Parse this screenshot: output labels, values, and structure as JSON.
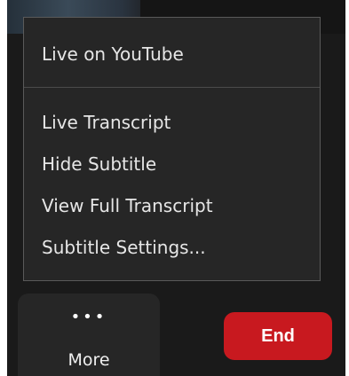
{
  "menu": {
    "items": [
      {
        "label": "Live on YouTube"
      },
      {
        "label": "Live Transcript"
      },
      {
        "label": "Hide Subtitle"
      },
      {
        "label": "View Full Transcript"
      },
      {
        "label": "Subtitle Settings..."
      }
    ]
  },
  "toolbar": {
    "more_icon": "more-dots-icon",
    "more_icon_glyph": "•••",
    "more_label": "More",
    "end_label": "End"
  },
  "colors": {
    "background": "#1a1a1a",
    "menu_background": "#262626",
    "menu_border": "#5a5a5a",
    "text": "#e6e6e6",
    "end_button": "#c8191f"
  }
}
